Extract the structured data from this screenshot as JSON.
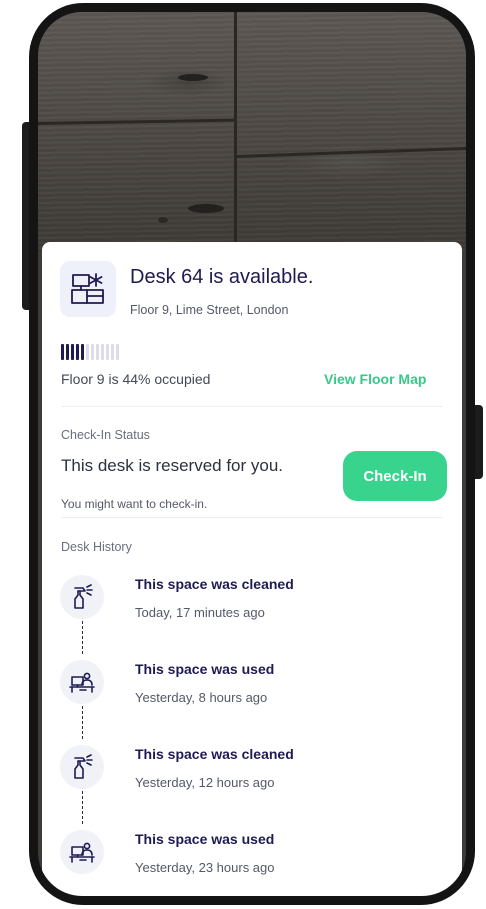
{
  "desk": {
    "title": "Desk 64 is available.",
    "location": "Floor 9, Lime Street, London"
  },
  "occupancy": {
    "text": "Floor 9 is 44% occupied",
    "level": 0.44,
    "filled_bars": 5,
    "total_bars": 12,
    "link_label": "View Floor Map"
  },
  "checkin": {
    "section_label": "Check-In Status",
    "status": "This desk is reserved for you.",
    "hint": "You might want to check-in.",
    "button_label": "Check-In"
  },
  "history": {
    "section_label": "Desk History",
    "items": [
      {
        "title": "This space was cleaned",
        "time": "Today, 17 minutes ago",
        "icon": "spray-bottle-icon"
      },
      {
        "title": "This space was used",
        "time": "Yesterday, 8 hours ago",
        "icon": "workstation-icon"
      },
      {
        "title": "This space was cleaned",
        "time": "Yesterday, 12 hours ago",
        "icon": "spray-bottle-icon"
      },
      {
        "title": "This space was used",
        "time": "Yesterday, 23 hours ago",
        "icon": "workstation-icon"
      }
    ]
  },
  "colors": {
    "accent": "#38d48e",
    "primary_text": "#1e1b52",
    "bar_filled": "#1e1b52",
    "bar_empty": "#dcdde8"
  }
}
